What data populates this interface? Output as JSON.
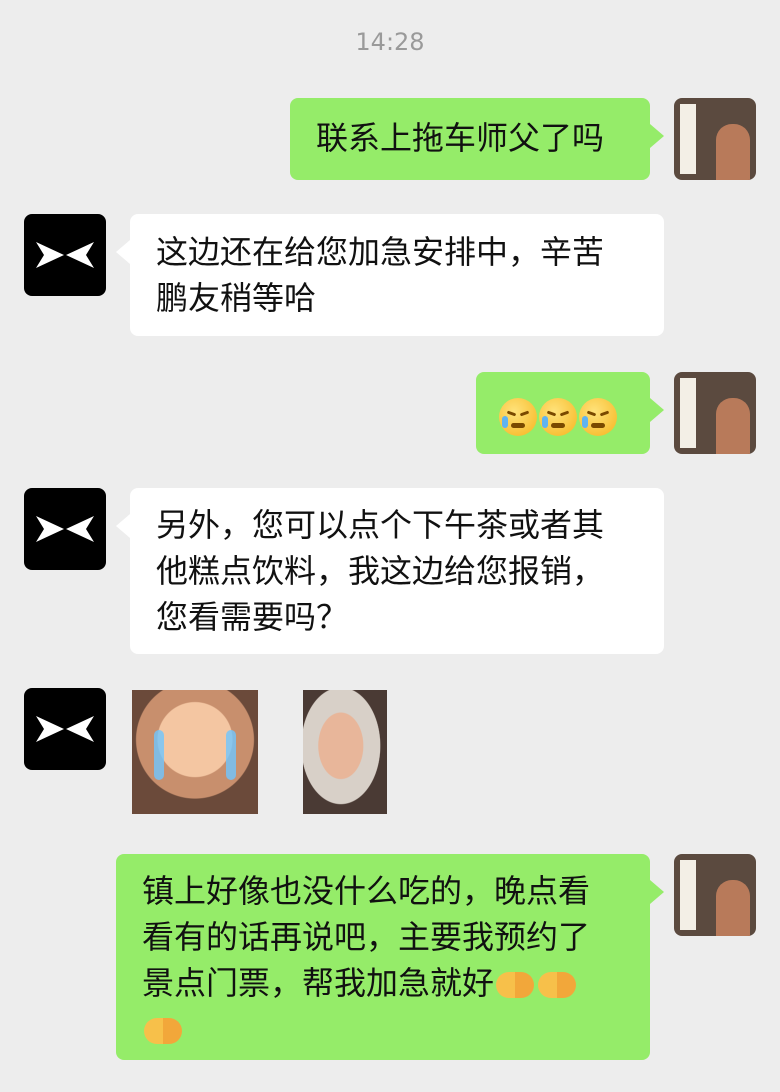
{
  "timestamp": "14:28",
  "messages": [
    {
      "side": "right",
      "text": "联系上拖车师父了吗"
    },
    {
      "side": "left",
      "lines": [
        "这边还在给您加急安排中，辛苦",
        "鹏友稍等哈"
      ]
    },
    {
      "side": "right",
      "emoji": [
        "crying-face",
        "crying-face",
        "crying-face"
      ]
    },
    {
      "side": "left",
      "lines": [
        "另外，您可以点个下午茶或者其",
        "他糕点饮料，我这边给您报销，",
        "您看需要吗？"
      ]
    },
    {
      "side": "left",
      "stickers": [
        "crying-baby-sticker",
        "baby-fist-sticker"
      ]
    },
    {
      "side": "right",
      "lines": [
        "镇上好像也没什么吃的，晚点看",
        "看有的话再说吧，主要我预约了",
        "景点门票，帮我加急就好"
      ],
      "trailing_emoji": [
        "handshake",
        "handshake",
        "handshake"
      ]
    }
  ],
  "colors": {
    "background": "#ededed",
    "outgoing_bubble": "#95ec69",
    "incoming_bubble": "#ffffff"
  }
}
